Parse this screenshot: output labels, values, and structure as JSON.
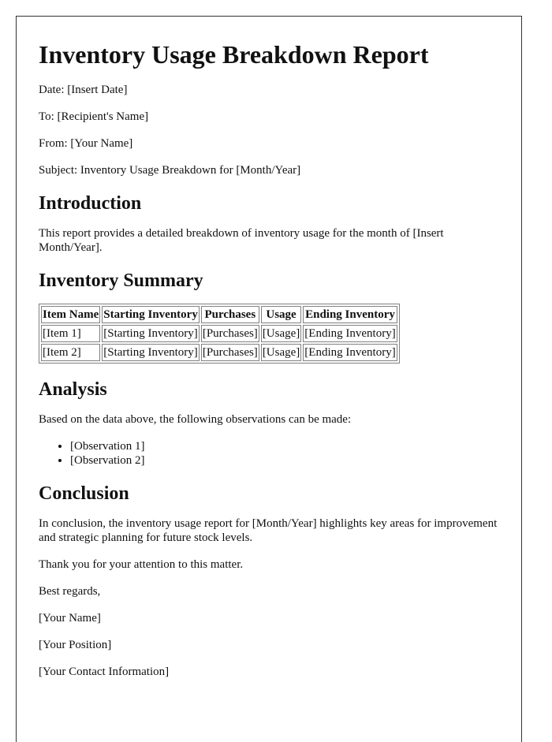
{
  "document": {
    "title": "Inventory Usage Breakdown Report",
    "header_lines": [
      "Date: [Insert Date]",
      "To: [Recipient's Name]",
      "From: [Your Name]",
      "Subject: Inventory Usage Breakdown for [Month/Year]"
    ],
    "sections": {
      "introduction": {
        "heading": "Introduction",
        "body": "This report provides a detailed breakdown of inventory usage for the month of [Insert Month/Year]."
      },
      "summary": {
        "heading": "Inventory Summary",
        "table": {
          "columns": [
            "Item Name",
            "Starting Inventory",
            "Purchases",
            "Usage",
            "Ending Inventory"
          ],
          "rows": [
            [
              "[Item 1]",
              "[Starting Inventory]",
              "[Purchases]",
              "[Usage]",
              "[Ending Inventory]"
            ],
            [
              "[Item 2]",
              "[Starting Inventory]",
              "[Purchases]",
              "[Usage]",
              "[Ending Inventory]"
            ]
          ]
        }
      },
      "analysis": {
        "heading": "Analysis",
        "body": "Based on the data above, the following observations can be made:",
        "observations": [
          "[Observation 1]",
          "[Observation 2]"
        ]
      },
      "conclusion": {
        "heading": "Conclusion",
        "body": "In conclusion, the inventory usage report for [Month/Year] highlights key areas for improvement and strategic planning for future stock levels."
      }
    },
    "closing": {
      "thanks": "Thank you for your attention to this matter.",
      "sign_off": "Best regards,",
      "name": "[Your Name]",
      "position": "[Your Position]",
      "contact": "[Your Contact Information]"
    }
  }
}
